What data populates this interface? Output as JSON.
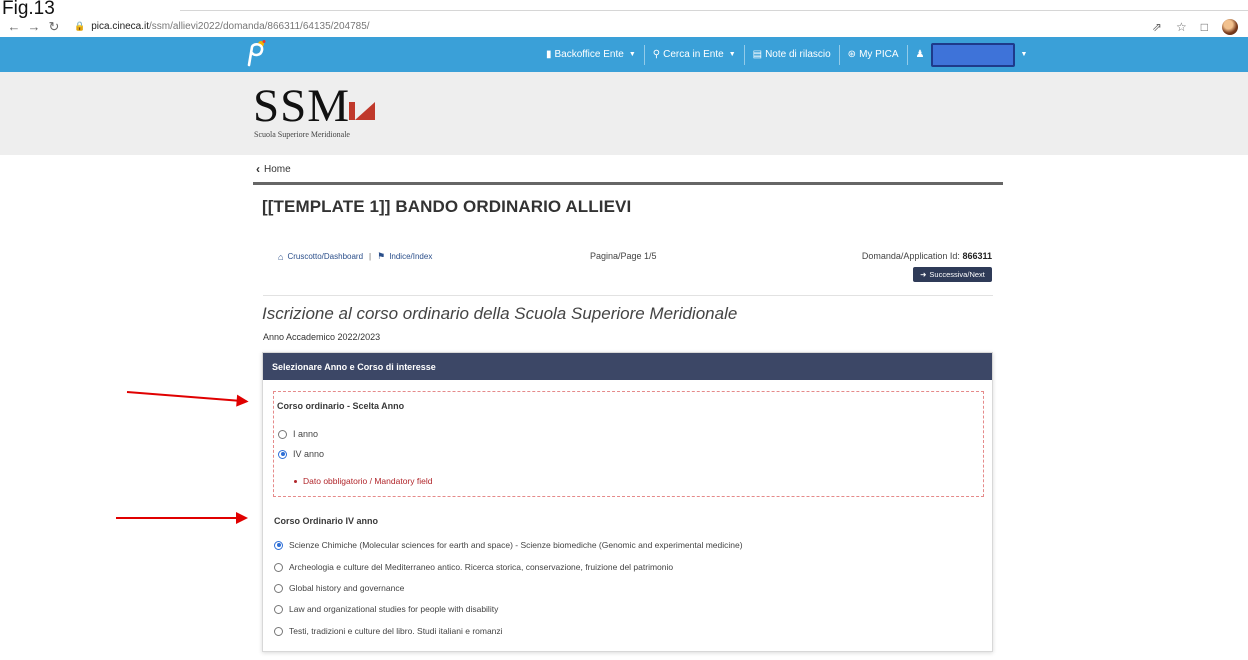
{
  "caption": "Fig.13",
  "browser": {
    "url_host": "pica.cineca.it",
    "url_path": "/ssm/allievi2022/domanda/866311/64135/204785/"
  },
  "navbar": {
    "items": [
      {
        "label": "Backoffice Ente"
      },
      {
        "label": "Cerca in Ente"
      },
      {
        "label": "Note di rilascio"
      },
      {
        "label": "My PICA"
      }
    ]
  },
  "logo": {
    "main": "SSM",
    "sub": "Scuola Superiore Meridionale"
  },
  "home_link": "Home",
  "page_title": "[[TEMPLATE 1]] BANDO ORDINARIO ALLIEVI",
  "toolbar": {
    "dashboard": "Cruscotto/Dashboard",
    "separator": "|",
    "index": "Indice/Index",
    "pagina": "Pagina/Page 1/5",
    "appid_label": "Domanda/Application Id:",
    "appid_value": "866311",
    "next": "Successiva/Next"
  },
  "section_title": "Iscrizione al corso ordinario della Scuola Superiore Meridionale",
  "academic_year": "Anno Accademico 2022/2023",
  "panel": {
    "header": "Selezionare Anno e Corso di interesse",
    "group1": {
      "label": "Corso ordinario - Scelta Anno",
      "options": [
        {
          "label": "I anno",
          "checked": false
        },
        {
          "label": "IV anno",
          "checked": true
        }
      ],
      "error": "Dato obbligatorio / Mandatory field"
    },
    "group2": {
      "label": "Corso Ordinario IV anno",
      "options": [
        {
          "label": "Scienze Chimiche (Molecular sciences for earth and space) - Scienze biomediche (Genomic and experimental medicine)",
          "checked": true
        },
        {
          "label": "Archeologia e culture del Mediterraneo antico. Ricerca storica, conservazione, fruizione del patrimonio",
          "checked": false
        },
        {
          "label": "Global history and governance",
          "checked": false
        },
        {
          "label": "Law and organizational studies for people with disability",
          "checked": false
        },
        {
          "label": "Testi, tradizioni e culture del libro. Studi italiani e romanzi",
          "checked": false
        }
      ]
    }
  },
  "colors": {
    "navbar": "#3aa0d8",
    "panel_header": "#3c4766",
    "error": "#b1262b",
    "annotation_arrow": "#e00000"
  }
}
